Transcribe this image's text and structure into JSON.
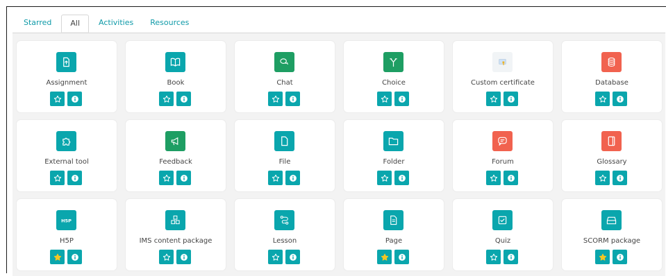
{
  "tabs": [
    {
      "label": "Starred",
      "active": false
    },
    {
      "label": "All",
      "active": true
    },
    {
      "label": "Activities",
      "active": false
    },
    {
      "label": "Resources",
      "active": false
    }
  ],
  "modules": [
    {
      "name": "Assignment",
      "icon": "assignment-icon",
      "color": "#0aa6ad",
      "starred": false
    },
    {
      "name": "Book",
      "icon": "book-icon",
      "color": "#0aa6ad",
      "starred": false
    },
    {
      "name": "Chat",
      "icon": "chat-icon",
      "color": "#1e9e63",
      "starred": false
    },
    {
      "name": "Choice",
      "icon": "choice-icon",
      "color": "#1e9e63",
      "starred": false
    },
    {
      "name": "Custom certificate",
      "icon": "certificate-icon",
      "color": "#f1f4f6",
      "starred": false
    },
    {
      "name": "Database",
      "icon": "database-icon",
      "color": "#f1624f",
      "starred": false
    },
    {
      "name": "External tool",
      "icon": "puzzle-icon",
      "color": "#0aa6ad",
      "starred": false
    },
    {
      "name": "Feedback",
      "icon": "megaphone-icon",
      "color": "#1e9e63",
      "starred": false
    },
    {
      "name": "File",
      "icon": "file-icon",
      "color": "#0aa6ad",
      "starred": false
    },
    {
      "name": "Folder",
      "icon": "folder-icon",
      "color": "#0aa6ad",
      "starred": false
    },
    {
      "name": "Forum",
      "icon": "forum-icon",
      "color": "#f1624f",
      "starred": false
    },
    {
      "name": "Glossary",
      "icon": "glossary-icon",
      "color": "#f1624f",
      "starred": false
    },
    {
      "name": "H5P",
      "icon": "h5p-icon",
      "color": "#0aa6ad",
      "starred": true
    },
    {
      "name": "IMS content package",
      "icon": "package-icon",
      "color": "#0aa6ad",
      "starred": false
    },
    {
      "name": "Lesson",
      "icon": "lesson-icon",
      "color": "#0aa6ad",
      "starred": false
    },
    {
      "name": "Page",
      "icon": "page-icon",
      "color": "#0aa6ad",
      "starred": true
    },
    {
      "name": "Quiz",
      "icon": "quiz-icon",
      "color": "#0aa6ad",
      "starred": false
    },
    {
      "name": "SCORM package",
      "icon": "scorm-icon",
      "color": "#0aa6ad",
      "starred": true
    }
  ],
  "star_icon": "star-icon",
  "info_icon": "info-icon",
  "colors": {
    "accent": "#0aa6ad",
    "star_active": "#f3c623"
  }
}
